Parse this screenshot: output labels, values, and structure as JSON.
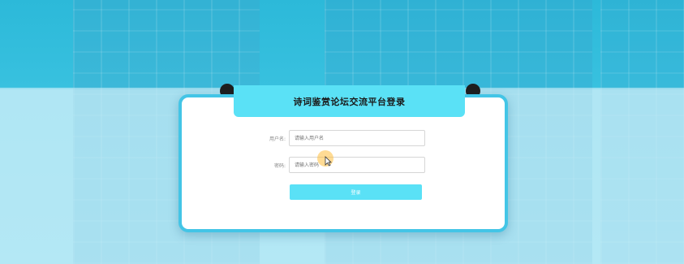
{
  "login": {
    "title": "诗词鉴赏论坛交流平台登录",
    "username_label": "用户名:",
    "username_placeholder": "请输入用户名",
    "password_label": "密码:",
    "password_placeholder": "请输入密码",
    "login_button": "登录"
  },
  "colors": {
    "accent": "#5ae1f6",
    "panel_border": "#43c5e6",
    "background_top": "#2cb9d9",
    "background_bottom": "#a8e2f1"
  },
  "icons": {
    "cursor": "mouse-pointer-icon"
  }
}
